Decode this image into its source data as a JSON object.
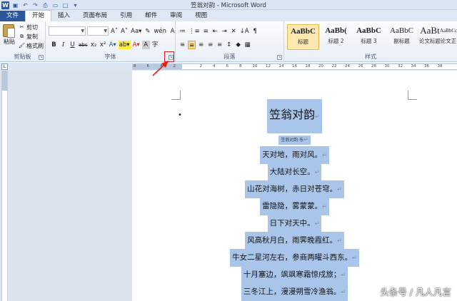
{
  "window": {
    "title": "笠翁对韵 - Microsoft Word",
    "qat_icons": [
      "word-icon",
      "save-icon",
      "undo-icon",
      "redo-icon",
      "print-preview-icon",
      "open-icon",
      "new-icon",
      "customize-icon"
    ]
  },
  "tabs": [
    "文件",
    "开始",
    "插入",
    "页面布局",
    "引用",
    "邮件",
    "审阅",
    "视图"
  ],
  "active_tab": "开始",
  "ribbon": {
    "clipboard": {
      "paste_label": "粘贴",
      "cut_label": "剪切",
      "copy_label": "复制",
      "format_painter_label": "格式刷",
      "group_label": "剪贴板"
    },
    "font": {
      "font_name_value": "",
      "font_size_value": "",
      "group_label": "字体",
      "buttons_row1": [
        "A˄",
        "A˅",
        "Aa▾",
        "✎",
        "wén",
        "A"
      ],
      "buttons_row2": [
        "B",
        "I",
        "U",
        "abc",
        "x₂",
        "x²",
        "A▾",
        "ab▾",
        "A▾",
        "A",
        "字"
      ]
    },
    "paragraph": {
      "group_label": "段落",
      "buttons_row1": [
        "≔",
        "⋮≡",
        "≡",
        "⇤",
        "⇥",
        "✕",
        "↓A",
        "¶"
      ],
      "buttons_row2": [
        "≡",
        "≡",
        "≡",
        "≡",
        "≡",
        "↕",
        "◆",
        "▦"
      ]
    },
    "styles": {
      "group_label": "样式",
      "items": [
        {
          "sample": "AaBbC",
          "name": "标题"
        },
        {
          "sample": "AaBb(",
          "name": "标题 2"
        },
        {
          "sample": "AaBbC",
          "name": "标题 3"
        },
        {
          "sample": "AaBbC",
          "name": "副标题"
        },
        {
          "sample": "AaBt",
          "name": "论文标题"
        },
        {
          "sample": "AaBbCcl",
          "name": "论文正"
        }
      ]
    }
  },
  "ruler": {
    "ticks": [
      "8",
      "6",
      "4",
      "2",
      "",
      "2",
      "4",
      "6",
      "8",
      "10",
      "12",
      "14",
      "16",
      "18",
      "20",
      "22",
      "24",
      "26",
      "28",
      "30",
      "32",
      "34",
      "36",
      "38"
    ]
  },
  "document": {
    "title": "笠翁对韵",
    "subtitle": "笠翁对韵·东",
    "lines": [
      "天对地，雨对风。",
      "大陆对长空。",
      "山花对海树，赤日对苍穹。",
      "雷隐隐，雾蒙蒙。",
      "日下对天中。",
      "风高秋月白，雨霁晚霞红。",
      "牛女二星河左右，参商两曜斗西东。",
      "十月塞边，飒飒寒霜惊戍旅；",
      "三冬江上，漫漫朔雪冷渔翁。"
    ],
    "para_mark": "↵"
  },
  "watermark": "头条号 / 凡人凡言",
  "colors": {
    "file_tab": "#2b579a",
    "selection": "#a9c6ea",
    "highlight_box": "#e0201a"
  }
}
